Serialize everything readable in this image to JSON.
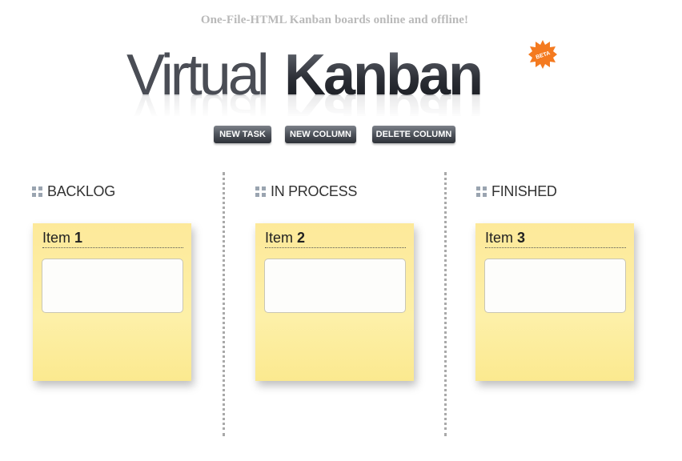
{
  "header": {
    "tagline": "One-File-HTML Kanban boards online and offline!",
    "logo_light": "Virtual",
    "logo_bold": "Kanban",
    "badge": "BETA"
  },
  "toolbar": {
    "new_task_label": "NEW TASK",
    "new_column_label": "NEW COLUMN",
    "delete_column_label": "DELETE COLUMN"
  },
  "columns": [
    {
      "title": "BACKLOG",
      "card": {
        "label": "Item",
        "number": "1",
        "body": ""
      }
    },
    {
      "title": "IN PROCESS",
      "card": {
        "label": "Item",
        "number": "2",
        "body": ""
      }
    },
    {
      "title": "FINISHED",
      "card": {
        "label": "Item",
        "number": "3",
        "body": ""
      }
    }
  ],
  "colors": {
    "card": "#fdf0a8",
    "button": "#4e535b",
    "badge": "#f47a20",
    "divider": "#a9a9a9"
  }
}
